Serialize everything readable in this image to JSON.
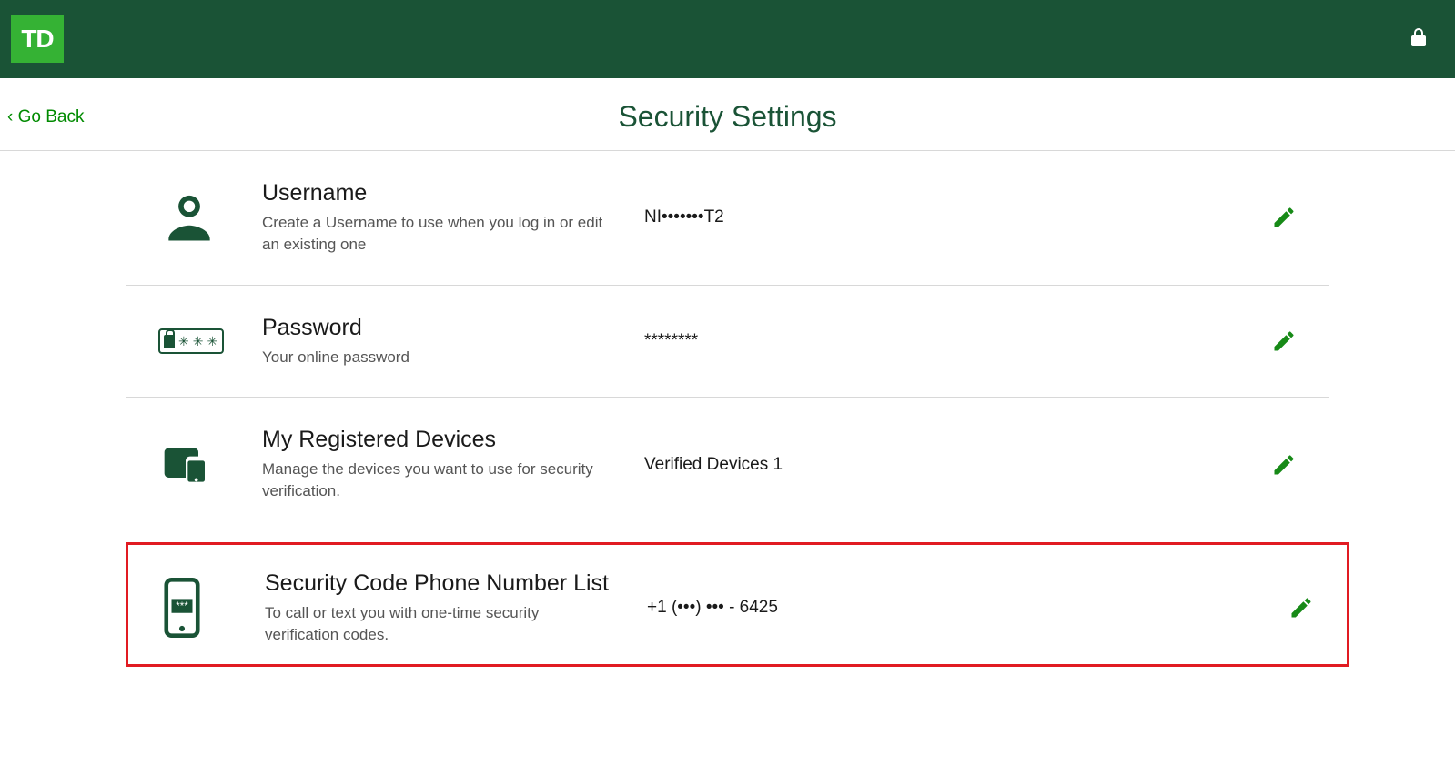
{
  "header": {
    "logo_text": "TD"
  },
  "nav": {
    "back_label": "‹ Go Back"
  },
  "page": {
    "title": "Security Settings"
  },
  "rows": {
    "username": {
      "title": "Username",
      "desc": "Create a Username to use when you log in or edit an existing one",
      "value": "NI•••••••T2"
    },
    "password": {
      "title": "Password",
      "desc": "Your online password",
      "value": "********"
    },
    "devices": {
      "title": "My Registered Devices",
      "desc": "Manage the devices you want to use for security verification.",
      "value": "Verified Devices 1"
    },
    "phone": {
      "title": "Security Code Phone Number List",
      "desc": "To call or text you with one-time security verification codes.",
      "value": "+1 (•••) ••• - 6425"
    }
  }
}
